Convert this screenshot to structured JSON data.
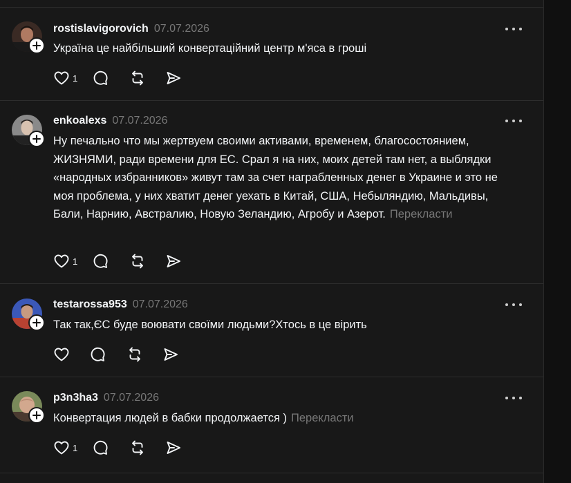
{
  "posts": [
    {
      "username": "rostislavigorovich",
      "date": "07.07.2026",
      "text": "Україна це найбільший конвертаційний центр м'яса в гроші",
      "translate": "",
      "likes": "1",
      "avatar_colors": [
        "#6b4a3e",
        "#2c2c2c"
      ]
    },
    {
      "username": "enkoalexs",
      "date": "07.07.2026",
      "text": "Ну печально что мы жертвуем своими активами, временем, благосостоянием, ЖИЗНЯМИ, ради времени для ЕС. Срал я на них, моих детей там нет, а выблядки «народных избранников» живут там за счет награбленных денег в Украине и это не моя проблема, у них хватит денег уехать в Китай, США, Небыляндию, Мальдивы, Бали, Нарнию, Австралию, Новую Зеландию, Агробу и Азерот.",
      "translate": "Перекласти",
      "likes": "1",
      "avatar_colors": [
        "#9a9a9a",
        "#3a3a3a"
      ]
    },
    {
      "username": "testarossa953",
      "date": "07.07.2026",
      "text": "Так так,ЄС буде воювати своїми людьми?Хтось в це вірить",
      "translate": "",
      "likes": "",
      "avatar_colors": [
        "#3a4fa8",
        "#c44a3a"
      ]
    },
    {
      "username": "p3n3ha3",
      "date": "07.07.2026",
      "text": "Конвертация людей в бабки продолжается )",
      "translate": "Перекласти",
      "likes": "1",
      "avatar_colors": [
        "#c9a48a",
        "#6a8a4a"
      ]
    }
  ],
  "colors": {
    "background": "#181818",
    "text": "#f3f5f7",
    "muted": "#777777",
    "divider": "#2d2d2d"
  },
  "icons": {
    "like": "heart-icon",
    "reply": "comment-icon",
    "repost": "repost-icon",
    "share": "share-icon",
    "more": "more-icon",
    "follow": "plus-icon"
  }
}
